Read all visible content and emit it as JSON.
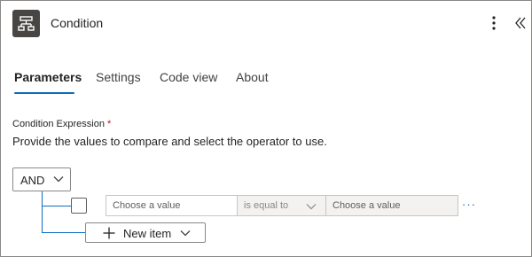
{
  "header": {
    "title": "Condition",
    "icon": "condition-icon",
    "more_icon": "more-vertical-icon",
    "collapse_icon": "double-chevron-left-icon"
  },
  "tabs": [
    {
      "label": "Parameters",
      "active": true
    },
    {
      "label": "Settings",
      "active": false
    },
    {
      "label": "Code view",
      "active": false
    },
    {
      "label": "About",
      "active": false
    }
  ],
  "condition": {
    "field_label": "Condition Expression",
    "required_mark": "*",
    "description": "Provide the values to compare and select the operator to use.",
    "group_operator": "AND",
    "rows": [
      {
        "checked": false,
        "left_placeholder": "Choose a value",
        "operator": "is equal to",
        "right_placeholder": "Choose a value",
        "more_label": "···"
      }
    ],
    "new_item_label": "New item"
  },
  "colors": {
    "accent": "#0f6cbd",
    "required": "#c50f1f",
    "icon_bg": "#484644"
  }
}
